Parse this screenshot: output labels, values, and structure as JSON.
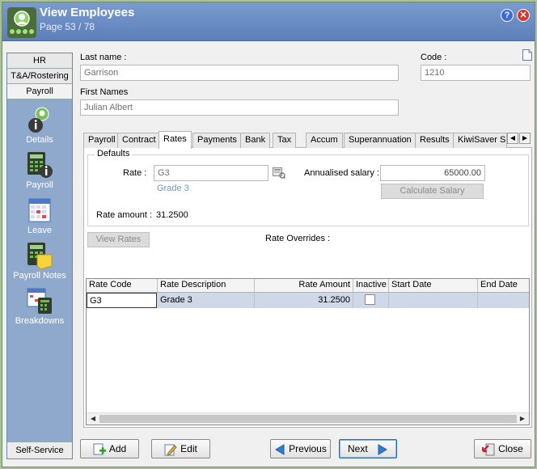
{
  "window": {
    "title": "View Employees",
    "page": "Page 53 / 78",
    "help_glyph": "?",
    "close_glyph": "✕"
  },
  "sidebar": {
    "tabs": [
      {
        "label": "HR"
      },
      {
        "label": "T&A/Rostering"
      },
      {
        "label": "Payroll"
      }
    ],
    "items": [
      {
        "label": "Details",
        "icon": "employee-info-icon"
      },
      {
        "label": "Payroll",
        "icon": "calculator-info-icon"
      },
      {
        "label": "Leave",
        "icon": "calendar-icon"
      },
      {
        "label": "Payroll Notes",
        "icon": "calculator-note-icon"
      },
      {
        "label": "Breakdowns",
        "icon": "calendar-calculator-icon"
      }
    ],
    "bottom_tab": "Self-Service"
  },
  "employee": {
    "last_name_label": "Last name :",
    "last_name": "Garrison",
    "code_label": "Code :",
    "code": "1210",
    "first_names_label": "First Names",
    "first_names": "Julian Albert"
  },
  "tabs": [
    {
      "label": "Payroll"
    },
    {
      "label": "Contract"
    },
    {
      "label": "Rates"
    },
    {
      "label": "Payments"
    },
    {
      "label": "Bank"
    },
    {
      "label": "Tax"
    },
    {
      "label": "Accum"
    },
    {
      "label": "Superannuation"
    },
    {
      "label": "Results"
    },
    {
      "label": "KiwiSaver S"
    }
  ],
  "tab_scroll": {
    "left": "◀",
    "right": "▶"
  },
  "defaults": {
    "title": "Defaults",
    "rate_label": "Rate :",
    "rate_value": "G3",
    "rate_description": "Grade 3",
    "annualised_label": "Annualised salary :",
    "annualised_value": "65000.00",
    "calculate_button": "Calculate Salary",
    "rate_amount_label": "Rate amount :",
    "rate_amount_value": "31.2500"
  },
  "view_rates_button": "View Rates",
  "rate_overrides_label": "Rate Overrides :",
  "grid": {
    "columns": [
      "Rate Code",
      "Rate Description",
      "Rate Amount",
      "Inactive",
      "Start Date",
      "End Date"
    ],
    "rows": [
      {
        "rate_code": "G3",
        "rate_description": "Grade 3",
        "rate_amount": "31.2500",
        "inactive": false,
        "start_date": "",
        "end_date": ""
      }
    ],
    "scroll": {
      "left": "◀",
      "right": "▶"
    }
  },
  "buttons": {
    "add": "Add",
    "edit": "Edit",
    "previous": "Previous",
    "next": "Next",
    "close": "Close"
  },
  "colors": {
    "titlebar": "#5c7fb9",
    "sidebar": "#8fa9cd",
    "selected_row": "#cfd8e6",
    "link": "#6a97c8"
  }
}
